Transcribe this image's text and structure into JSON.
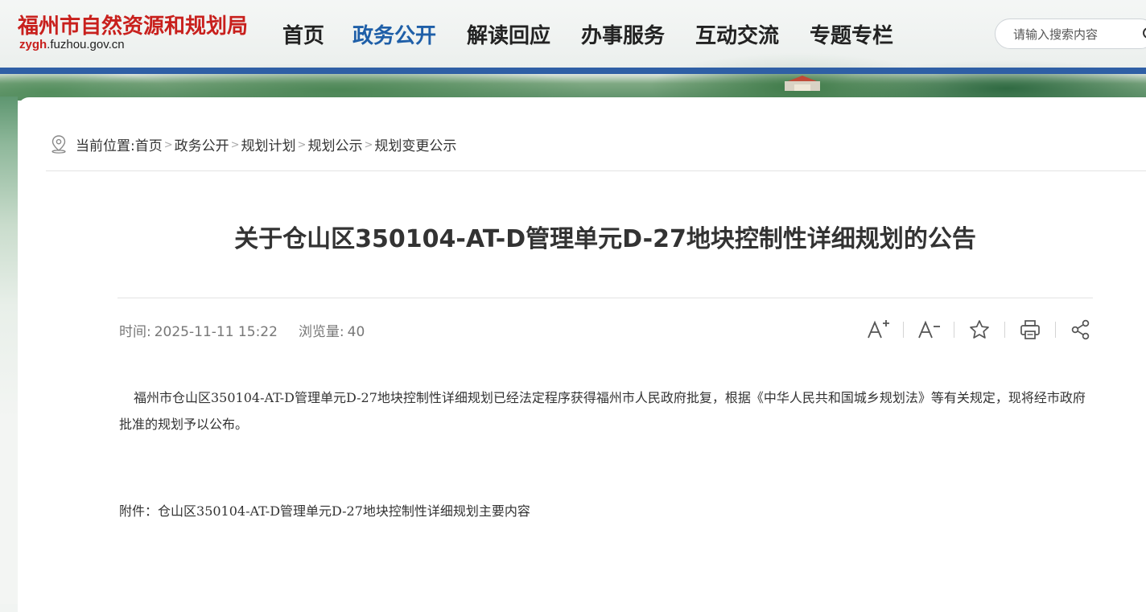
{
  "header": {
    "logo_cn": "福州市自然资源和规划局",
    "logo_url_bold": "zygh",
    "logo_url_rest": ".fuzhou.gov.cn",
    "nav": [
      {
        "label": "首页"
      },
      {
        "label": "政务公开",
        "active": true
      },
      {
        "label": "解读回应"
      },
      {
        "label": "办事服务"
      },
      {
        "label": "互动交流"
      },
      {
        "label": "专题专栏"
      }
    ],
    "search": {
      "placeholder": "请输入搜索内容",
      "value": ""
    }
  },
  "breadcrumb": {
    "label": "当前位置:",
    "items": [
      "首页",
      "政务公开",
      "规划计划",
      "规划公示",
      "规划变更公示"
    ],
    "separator": ">"
  },
  "article": {
    "title": "关于仓山区350104-AT-D管理单元D-27地块控制性详细规划的公告",
    "time_label": "时间:",
    "time_value": "2025-11-11 15:22",
    "views_label": "浏览量:",
    "views_value": "40",
    "tools": [
      "font-increase-icon",
      "font-decrease-icon",
      "star-icon",
      "print-icon",
      "share-icon"
    ],
    "body": "福州市仓山区350104-AT-D管理单元D-27地块控制性详细规划已经法定程序获得福州市人民政府批复，根据《中华人民共和国城乡规划法》等有关规定，现将经市政府批准的规划予以公布。",
    "attachment_label": "附件：",
    "attachment_title": "仓山区350104-AT-D管理单元D-27地块控制性详细规划主要内容"
  },
  "colors": {
    "brand_red": "#c8201d",
    "nav_active": "#1f5fa8",
    "blue_rule": "#2f5fa5"
  }
}
